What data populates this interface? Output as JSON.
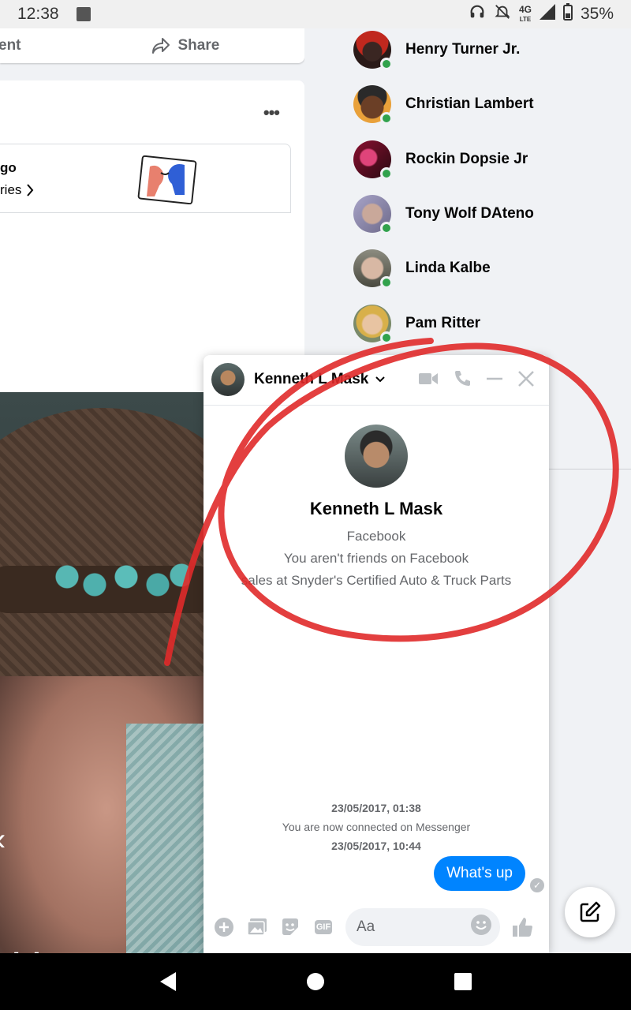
{
  "status_bar": {
    "time": "12:38",
    "network": "4G",
    "network_sub": "LTE",
    "battery": "35%"
  },
  "feed": {
    "comment_partial": "ent",
    "share_label": "Share",
    "more_label": "•••",
    "link_title_partial": "go",
    "link_sub_partial": "ries"
  },
  "contacts": [
    {
      "name": "Henry Turner Jr.",
      "online": true
    },
    {
      "name": "Christian Lambert",
      "online": true
    },
    {
      "name": "Rockin Dopsie Jr",
      "online": true
    },
    {
      "name": "Tony Wolf DAteno",
      "online": true
    },
    {
      "name": "Linda Kalbe",
      "online": true
    },
    {
      "name": "Pam Ritter",
      "online": true
    }
  ],
  "chat": {
    "header_name": "Kenneth L Mask",
    "profile_name": "Kenneth L Mask",
    "profile_source": "Facebook",
    "profile_relation": "You aren't friends on Facebook",
    "profile_work": "sales at Snyder's Certified Auto & Truck Parts",
    "timestamp_1": "23/05/2017, 01:38",
    "connected_text": "You are now connected on Messenger",
    "timestamp_2": "23/05/2017, 10:44",
    "message": "What's up",
    "input_placeholder": "Aa",
    "gif_label": "GIF"
  },
  "colors": {
    "accent": "#0084ff",
    "online": "#31a24c",
    "annotation": "#e02a2a",
    "page_bg": "#f0f2f5"
  },
  "icons": [
    "headphones-icon",
    "mute-icon",
    "signal-icon",
    "battery-icon",
    "share-icon",
    "chevron-right-icon",
    "chevron-down-icon",
    "video-call-icon",
    "phone-icon",
    "minimize-icon",
    "close-icon",
    "plus-icon",
    "photo-icon",
    "sticker-icon",
    "gif-icon",
    "emoji-icon",
    "like-icon",
    "compose-icon",
    "back-icon",
    "home-icon",
    "recents-icon"
  ]
}
